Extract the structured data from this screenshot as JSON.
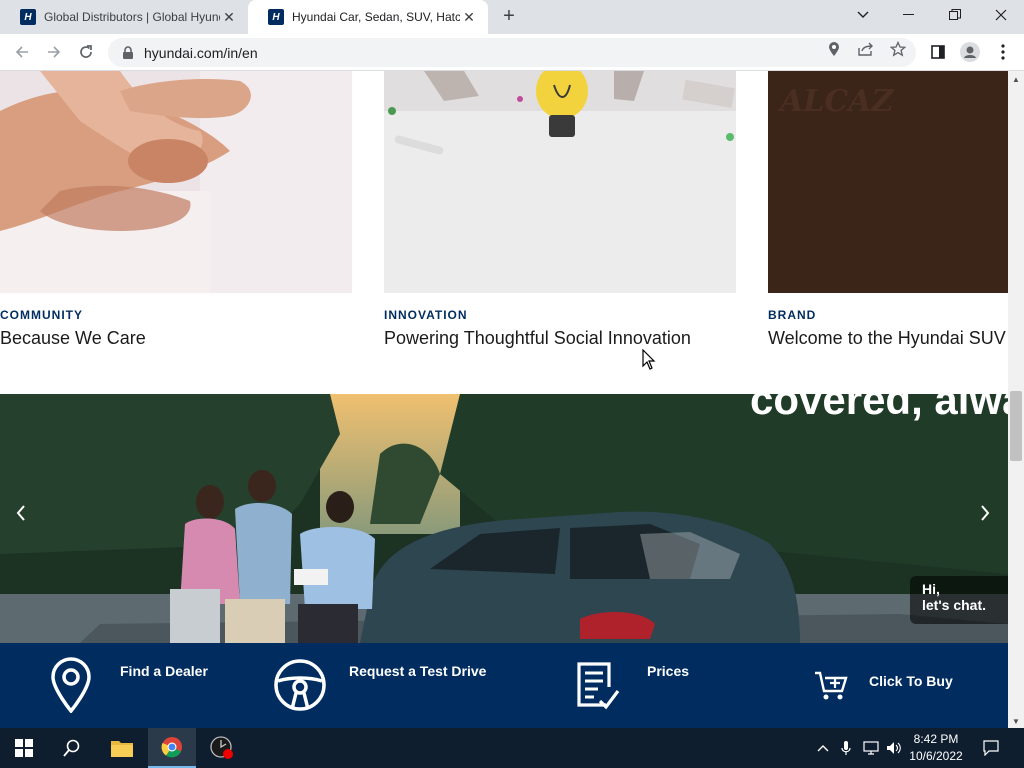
{
  "browser": {
    "tabs": [
      {
        "title": "Global Distributors | Global Hyundai",
        "favicon": "hyundai-favicon",
        "active": false
      },
      {
        "title": "Hyundai Car, Sedan, SUV, Hatchback",
        "favicon": "hyundai-favicon",
        "active": true
      }
    ],
    "new_tab_label": "+",
    "url": "hyundai.com/in/en"
  },
  "page": {
    "cards": [
      {
        "category": "COMMUNITY",
        "title": "Because We Care"
      },
      {
        "category": "INNOVATION",
        "title": "Powering Thoughtful Social Innovation"
      },
      {
        "category": "BRAND",
        "title": "Welcome to the Hyundai SUV"
      }
    ],
    "banner": {
      "headline": "covered, alwa",
      "chat_line1": "Hi,",
      "chat_line2": "let's chat."
    },
    "quick_links": [
      {
        "label": "Find a Dealer",
        "icon": "location-pin-icon"
      },
      {
        "label": "Request a Test Drive",
        "icon": "steering-wheel-icon"
      },
      {
        "label": "Prices",
        "icon": "price-list-icon"
      },
      {
        "label": "Click To Buy",
        "icon": "shopping-cart-icon"
      }
    ],
    "colors": {
      "brand_navy": "#002c5f"
    }
  },
  "taskbar": {
    "time": "8:42 PM",
    "date": "10/6/2022"
  }
}
